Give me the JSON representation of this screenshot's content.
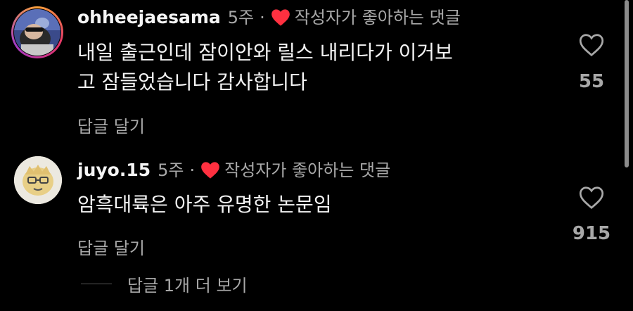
{
  "colors": {
    "background": "#000000",
    "text_primary": "#f5f5f5",
    "text_secondary": "#a8a8a8",
    "liked_heart": "#ff3040"
  },
  "comments": [
    {
      "username": "ohheejaesama",
      "time_ago": "5주",
      "separator": "·",
      "liked_by_author_label": "작성자가 좋아하는 댓글",
      "text_lines": [
        "내일 출근인데 잠이안와 릴스 내리다가 이거보",
        "고 잠들었습니다 감사합니다"
      ],
      "reply_label": "답글 달기",
      "like_count": "55",
      "icon_like": "heart-outline-icon",
      "icon_liked_by_author": "heart-filled-icon"
    },
    {
      "username": "juyo.15",
      "time_ago": "5주",
      "separator": "·",
      "liked_by_author_label": "작성자가 좋아하는 댓글",
      "text_lines": [
        "암흑대륙은 아주 유명한 논문임"
      ],
      "reply_label": "답글 달기",
      "like_count": "915",
      "icon_like": "heart-outline-icon",
      "icon_liked_by_author": "heart-filled-icon",
      "view_replies_label": "답글 1개 더 보기"
    }
  ]
}
